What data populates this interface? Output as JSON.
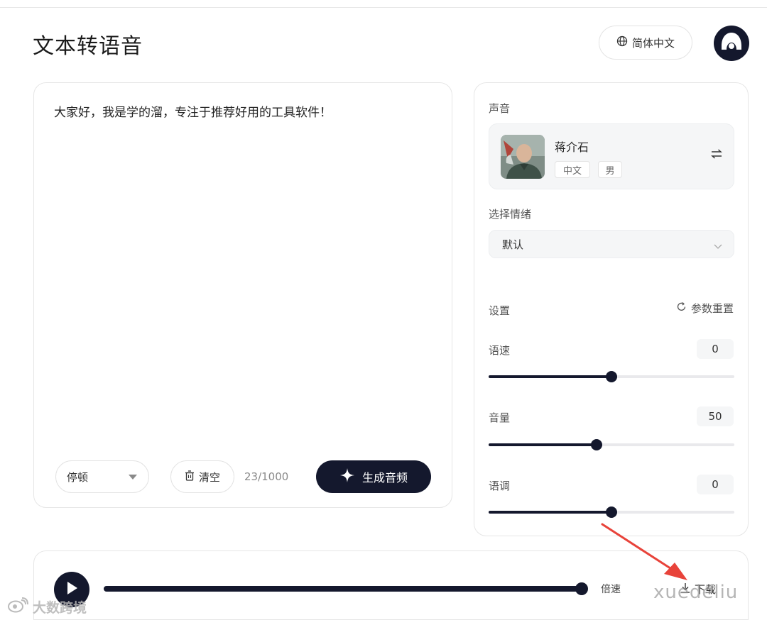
{
  "header": {
    "title": "文本转语音",
    "language_label": "简体中文",
    "icons": {
      "language": "globe-icon",
      "avatar": "user-avatar-icon"
    }
  },
  "editor": {
    "text": "大家好，我是学的溜，专注于推荐好用的工具软件！",
    "pause_label": "停顿",
    "clear_label": "清空",
    "char_count": "23/1000",
    "generate_label": "生成音频",
    "icons": {
      "pause": "chevron-down-icon",
      "clear": "trash-icon",
      "generate": "sparkle-icon"
    }
  },
  "settings": {
    "voice_section_label": "声音",
    "voice": {
      "name": "蒋介石",
      "tags": [
        "中文",
        "男"
      ]
    },
    "emotion_label": "选择情绪",
    "emotion_value": "默认",
    "settings_label": "设置",
    "reset_label": "参数重置",
    "sliders": [
      {
        "label": "语速",
        "value": "0",
        "fraction": 0.5
      },
      {
        "label": "音量",
        "value": "50",
        "fraction": 0.44
      },
      {
        "label": "语调",
        "value": "0",
        "fraction": 0.5
      }
    ],
    "icons": {
      "swap": "swap-icon",
      "emotion": "chevron-down-icon",
      "reset": "refresh-icon"
    }
  },
  "player": {
    "progress_fraction": 1.0,
    "speed_label": "倍速",
    "download_label": "下载",
    "icons": {
      "play": "play-icon",
      "download": "download-icon"
    }
  },
  "watermarks": {
    "left": "大数跨境",
    "right": "xuedeliu"
  },
  "colors": {
    "primary": "#14182d",
    "annotation_arrow": "#e8433a"
  }
}
